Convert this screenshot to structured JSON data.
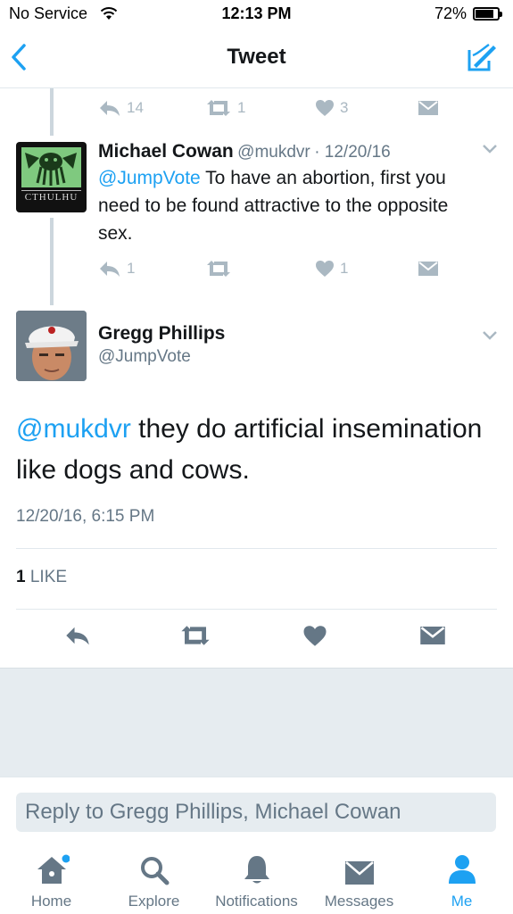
{
  "status_bar": {
    "carrier": "No Service",
    "time": "12:13 PM",
    "battery": "72%"
  },
  "nav": {
    "title": "Tweet"
  },
  "prev_tweet_actions": {
    "replies": "14",
    "retweets": "1",
    "likes": "3"
  },
  "reply_tweet": {
    "name": "Michael Cowan",
    "handle": "@mukdvr",
    "date": "· 12/20/16",
    "mention": "@JumpVote",
    "text": " To have an abortion, first you need to be found attractive to the opposite sex.",
    "avatar_text": "CTHULHU",
    "actions": {
      "replies": "1",
      "retweets": "",
      "likes": "1"
    }
  },
  "main_tweet": {
    "name": "Gregg Phillips",
    "handle": "@JumpVote",
    "mention": "@mukdvr",
    "text": " they do artificial insemination like dogs and cows.",
    "timestamp": "12/20/16, 6:15 PM",
    "like_count": "1",
    "like_label": " LIKE"
  },
  "reply_box": {
    "placeholder": "Reply to Gregg Phillips, Michael Cowan"
  },
  "tabs": [
    {
      "label": "Home",
      "icon": "home-icon"
    },
    {
      "label": "Explore",
      "icon": "search-icon"
    },
    {
      "label": "Notifications",
      "icon": "bell-icon"
    },
    {
      "label": "Messages",
      "icon": "envelope-icon"
    },
    {
      "label": "Me",
      "icon": "person-icon"
    }
  ],
  "colors": {
    "accent": "#1da1f2",
    "muted": "#aab8c2",
    "text": "#14171a"
  }
}
